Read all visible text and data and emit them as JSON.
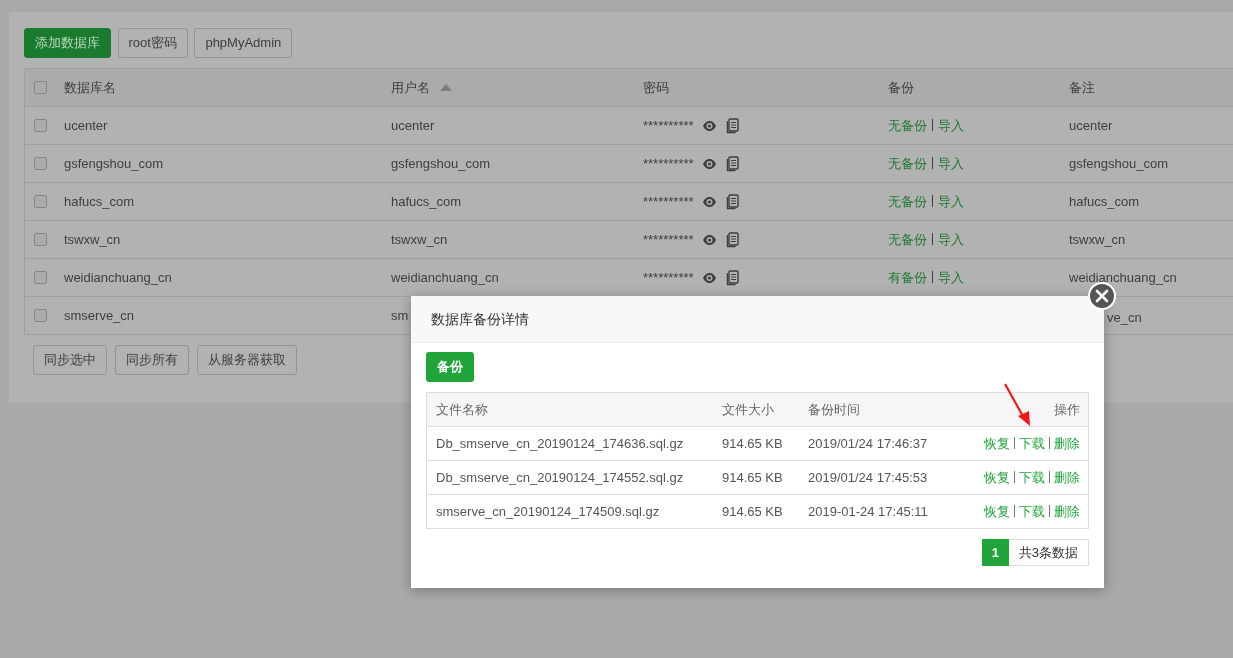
{
  "toolbar": {
    "buttons": [
      {
        "label": "添加数据库",
        "kind": "primary"
      },
      {
        "label": "root密码",
        "kind": "default"
      },
      {
        "label": "phpMyAdmin",
        "kind": "default"
      }
    ]
  },
  "table": {
    "select_all": {
      "checked": false
    },
    "columns": [
      {
        "label": "数据库名"
      },
      {
        "label": "用户名",
        "sorted": true
      },
      {
        "label": "密码"
      },
      {
        "label": "备份"
      },
      {
        "label": "备注"
      }
    ],
    "rows": [
      {
        "checked": false,
        "name": "ucenter",
        "user": "ucenter",
        "password": "**********",
        "backup_status": "无备份",
        "backup_import": "导入",
        "remark": "ucenter"
      },
      {
        "checked": false,
        "name": "gsfengshou_com",
        "user": "gsfengshou_com",
        "password": "**********",
        "backup_status": "无备份",
        "backup_import": "导入",
        "remark": "gsfengshou_com"
      },
      {
        "checked": false,
        "name": "hafucs_com",
        "user": "hafucs_com",
        "password": "**********",
        "backup_status": "无备份",
        "backup_import": "导入",
        "remark": "hafucs_com"
      },
      {
        "checked": false,
        "name": "tswxw_cn",
        "user": "tswxw_cn",
        "password": "**********",
        "backup_status": "无备份",
        "backup_import": "导入",
        "remark": "tswxw_cn"
      },
      {
        "checked": false,
        "name": "weidianchuang_cn",
        "user": "weidianchuang_cn",
        "password": "**********",
        "backup_status": "有备份",
        "backup_import": "导入",
        "remark": "weidianchuang_cn"
      },
      {
        "checked": false,
        "name": "smserve_cn",
        "user": "sm",
        "remark": "ve_cn"
      }
    ]
  },
  "footer_buttons": [
    "同步选中",
    "同步所有",
    "从服务器获取"
  ],
  "dialog": {
    "title": "数据库备份详情",
    "backup_button": "备份",
    "columns": [
      "文件名称",
      "文件大小",
      "备份时间",
      "操作"
    ],
    "files": [
      {
        "name": "Db_smserve_cn_20190124_174636.sql.gz",
        "size": "914.65 KB",
        "time": "2019/01/24 17:46:37",
        "actions": [
          "恢复",
          "下载",
          "删除"
        ]
      },
      {
        "name": "Db_smserve_cn_20190124_174552.sql.gz",
        "size": "914.65 KB",
        "time": "2019/01/24 17:45:53",
        "actions": [
          "恢复",
          "下载",
          "删除"
        ]
      },
      {
        "name": "smserve_cn_20190124_174509.sql.gz",
        "size": "914.65 KB",
        "time": "2019-01-24 17:45:11",
        "actions": [
          "恢复",
          "下载",
          "删除"
        ]
      }
    ],
    "pagination": {
      "pages": [
        {
          "label": "1",
          "selected": true
        }
      ],
      "total": "共3条数据"
    }
  }
}
